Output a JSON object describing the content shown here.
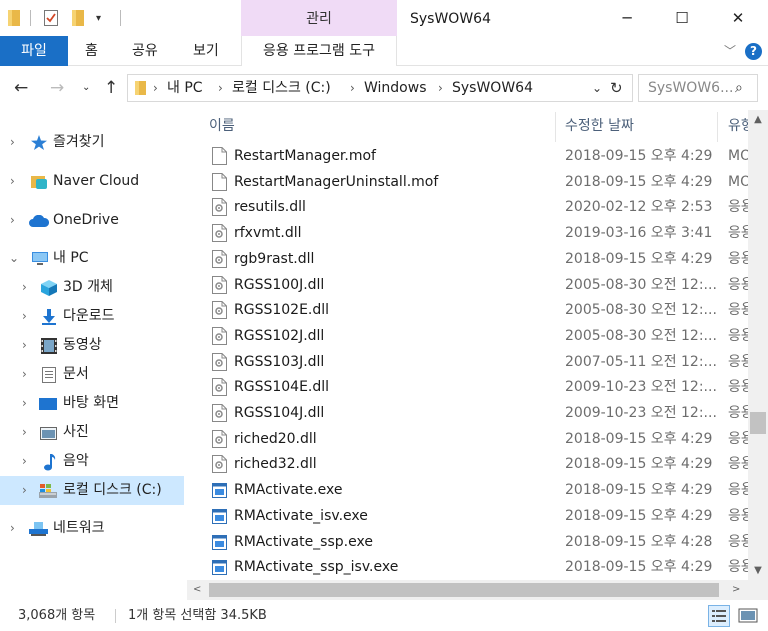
{
  "titlebar": {
    "context_tab": "관리",
    "window_title": "SysWOW64",
    "minimize_glyph": "─",
    "maximize_glyph": "☐",
    "close_glyph": "✕",
    "quick_access_dropdown_glyph": "▾"
  },
  "ribbon": {
    "file": "파일",
    "home": "홈",
    "share": "공유",
    "view": "보기",
    "tools": "응용 프로그램 도구",
    "expand_glyph": "﹀",
    "help_glyph": "?"
  },
  "address": {
    "back_glyph": "←",
    "forward_glyph": "→",
    "recent_glyph": "⌄",
    "up_glyph": "↑",
    "separator_glyph": "›",
    "crumbs": [
      "내 PC",
      "로컬 디스크 (C:)",
      "Windows",
      "SysWOW64"
    ],
    "dropdown_glyph": "⌄",
    "refresh_glyph": "↻",
    "search_placeholder": "SysWOW6...",
    "search_glyph": "⌕"
  },
  "navpane": {
    "chevron_collapsed": "›",
    "chevron_expanded": "⌄",
    "items": [
      {
        "label": "즐겨찾기",
        "icon": "star-icon"
      },
      {
        "label": "Naver Cloud",
        "icon": "naver-cloud-icon"
      },
      {
        "label": "OneDrive",
        "icon": "onedrive-icon"
      },
      {
        "label": "내 PC",
        "icon": "this-pc-icon"
      },
      {
        "label": "3D 개체",
        "icon": "3d-objects-icon"
      },
      {
        "label": "다운로드",
        "icon": "download-icon"
      },
      {
        "label": "동영상",
        "icon": "video-icon"
      },
      {
        "label": "문서",
        "icon": "document-icon"
      },
      {
        "label": "바탕 화면",
        "icon": "desktop-icon"
      },
      {
        "label": "사진",
        "icon": "pictures-icon"
      },
      {
        "label": "음악",
        "icon": "music-icon"
      },
      {
        "label": "로컬 디스크 (C:)",
        "icon": "local-disk-icon"
      },
      {
        "label": "네트워크",
        "icon": "network-icon"
      }
    ]
  },
  "filelist": {
    "columns": {
      "name": "이름",
      "date": "수정한 날짜",
      "type": "유형"
    },
    "sort_glyph": "^",
    "rows": [
      {
        "name": "RestartManager.mof",
        "date": "2018-09-15 오후 4:29",
        "type": "MO",
        "icon": "mof-file-icon"
      },
      {
        "name": "RestartManagerUninstall.mof",
        "date": "2018-09-15 오후 4:29",
        "type": "MO",
        "icon": "mof-file-icon"
      },
      {
        "name": "resutils.dll",
        "date": "2020-02-12 오후 2:53",
        "type": "응용",
        "icon": "dll-file-icon"
      },
      {
        "name": "rfxvmt.dll",
        "date": "2019-03-16 오후 3:41",
        "type": "응용",
        "icon": "dll-file-icon"
      },
      {
        "name": "rgb9rast.dll",
        "date": "2018-09-15 오후 4:29",
        "type": "응용",
        "icon": "dll-file-icon"
      },
      {
        "name": "RGSS100J.dll",
        "date": "2005-08-30 오전 12:...",
        "type": "응용",
        "icon": "dll-file-icon"
      },
      {
        "name": "RGSS102E.dll",
        "date": "2005-08-30 오전 12:...",
        "type": "응용",
        "icon": "dll-file-icon"
      },
      {
        "name": "RGSS102J.dll",
        "date": "2005-08-30 오전 12:...",
        "type": "응용",
        "icon": "dll-file-icon"
      },
      {
        "name": "RGSS103J.dll",
        "date": "2007-05-11 오전 12:...",
        "type": "응용",
        "icon": "dll-file-icon"
      },
      {
        "name": "RGSS104E.dll",
        "date": "2009-10-23 오전 12:...",
        "type": "응용",
        "icon": "dll-file-icon"
      },
      {
        "name": "RGSS104J.dll",
        "date": "2009-10-23 오전 12:...",
        "type": "응용",
        "icon": "dll-file-icon"
      },
      {
        "name": "riched20.dll",
        "date": "2018-09-15 오후 4:29",
        "type": "응용",
        "icon": "dll-file-icon"
      },
      {
        "name": "riched32.dll",
        "date": "2018-09-15 오후 4:29",
        "type": "응용",
        "icon": "dll-file-icon"
      },
      {
        "name": "RMActivate.exe",
        "date": "2018-09-15 오후 4:29",
        "type": "응용",
        "icon": "exe-file-icon"
      },
      {
        "name": "RMActivate_isv.exe",
        "date": "2018-09-15 오후 4:29",
        "type": "응용",
        "icon": "exe-file-icon"
      },
      {
        "name": "RMActivate_ssp.exe",
        "date": "2018-09-15 오후 4:28",
        "type": "응용",
        "icon": "exe-file-icon"
      },
      {
        "name": "RMActivate_ssp_isv.exe",
        "date": "2018-09-15 오후 4:29",
        "type": "응용",
        "icon": "exe-file-icon"
      }
    ]
  },
  "scroll": {
    "up_glyph": "▲",
    "down_glyph": "▼",
    "left_glyph": "<",
    "right_glyph": ">"
  },
  "statusbar": {
    "count": "3,068개 항목",
    "selection": "1개 항목 선택함 34.5KB"
  },
  "colors": {
    "accent": "#1a6fc6",
    "context_tab": "#f0dbf6",
    "selected_nav": "#cde8ff",
    "header_text": "#4c607a"
  }
}
